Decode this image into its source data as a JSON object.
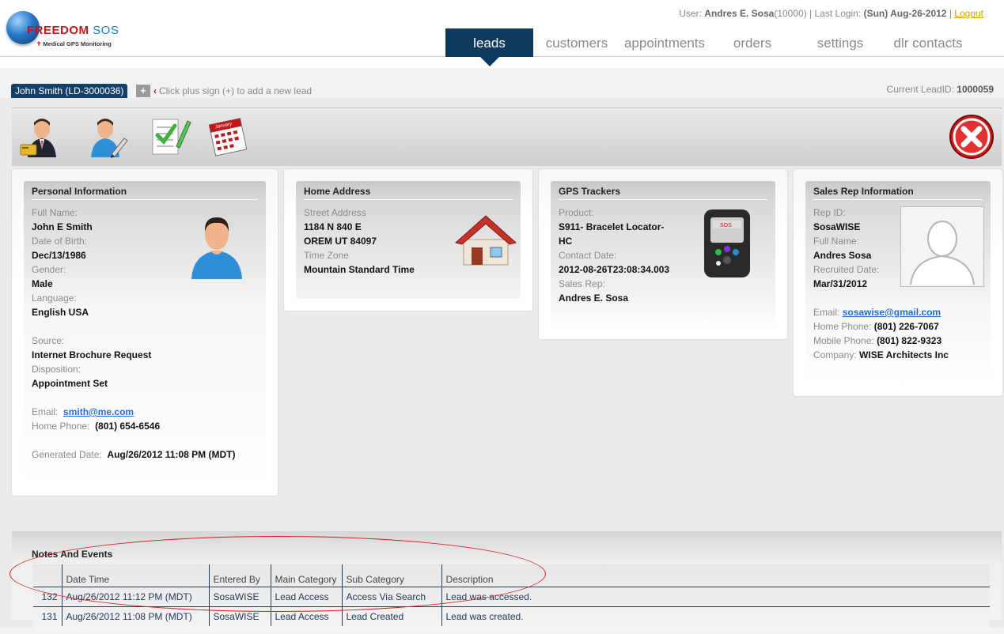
{
  "logo": {
    "brand1": "FREEDOM",
    "brand2": "SOS",
    "tagline": "Medical GPS Monitoring"
  },
  "userline": {
    "user_label": "User:",
    "user_name": "Andres E. Sosa",
    "user_id": "(10000)",
    "sep": "|",
    "login_label": "Last Login:",
    "login_value": "(Sun) Aug-26-2012",
    "logout": "Logout"
  },
  "nav": [
    {
      "label": "leads",
      "active": true
    },
    {
      "label": "customers"
    },
    {
      "label": "appointments"
    },
    {
      "label": "orders"
    },
    {
      "label": "settings"
    },
    {
      "label": "dlr contacts"
    }
  ],
  "leadbar": {
    "lead_tab": "John Smith (LD-3000036)",
    "plus": "+",
    "hint_arrow": "‹",
    "hint": "Click plus sign (+) to add a new lead",
    "current_label": "Current LeadID:",
    "current_value": "1000059"
  },
  "toolbar": {
    "icons": [
      "lead-card-icon",
      "edit-person-icon",
      "checklist-icon",
      "calendar-icon",
      "close-icon"
    ],
    "calendar_month": "January"
  },
  "personal": {
    "title": "Personal Information",
    "full_name_label": "Full Name:",
    "full_name": "John E Smith",
    "dob_label": "Date of Birth:",
    "dob": "Dec/13/1986",
    "gender_label": "Gender:",
    "gender": "Male",
    "language_label": "Language:",
    "language": "English USA",
    "source_label": "Source:",
    "source": "Internet Brochure Request",
    "disposition_label": "Disposition:",
    "disposition": "Appointment Set",
    "email_label": "Email:",
    "email": "smith@me.com",
    "phone_label": "Home Phone:",
    "phone": "(801) 654-6546",
    "generated_label": "Generated Date:",
    "generated": "Aug/26/2012 11:08 PM (MDT)"
  },
  "address": {
    "title": "Home Address",
    "street_label": "Street Address",
    "street": "1184 N 840 E",
    "city": "OREM UT 84097",
    "tz_label": "Time Zone",
    "tz": "Mountain Standard Time"
  },
  "gps": {
    "title": "GPS Trackers",
    "product_label": "Product:",
    "product_line1": "S911- Bracelet Locator-",
    "product_line2": "HC",
    "contact_label": "Contact Date:",
    "contact": "2012-08-26T23:08:34.003",
    "rep_label": "Sales Rep:",
    "rep": "Andres E. Sosa",
    "device_text": "SOS"
  },
  "salesrep": {
    "title": "Sales Rep Information",
    "rep_id_label": "Rep ID:",
    "rep_id": "SosaWISE",
    "full_name_label": "Full Name:",
    "full_name": "Andres Sosa",
    "recruited_label": "Recruited Date:",
    "recruited": "Mar/31/2012",
    "email_label": "Email:",
    "email": "sosawise@gmail.com",
    "home_label": "Home Phone:",
    "home": "(801) 226-7067",
    "mobile_label": "Mobile Phone:",
    "mobile": "(801) 822-9323",
    "company_label": "Company:",
    "company": "WISE Architects Inc"
  },
  "notes": {
    "title": "Notes And Events",
    "columns": [
      "",
      "Date Time",
      "Entered By",
      "Main Category",
      "Sub Category",
      "Description"
    ],
    "rows": [
      [
        "132",
        "Aug/26/2012 11:12 PM (MDT)",
        "SosaWISE",
        "Lead Access",
        "Access Via Search",
        "Lead was accessed."
      ],
      [
        "131",
        "Aug/26/2012 11:08 PM (MDT)",
        "SosaWISE",
        "Lead Access",
        "Lead Created",
        "Lead was created."
      ]
    ]
  },
  "colors": {
    "nav_active": "#0f3a5c",
    "lead_tab": "#14406a",
    "logout": "#d1a000",
    "link": "#1f6fd1",
    "annotation": "#d41a1a"
  }
}
